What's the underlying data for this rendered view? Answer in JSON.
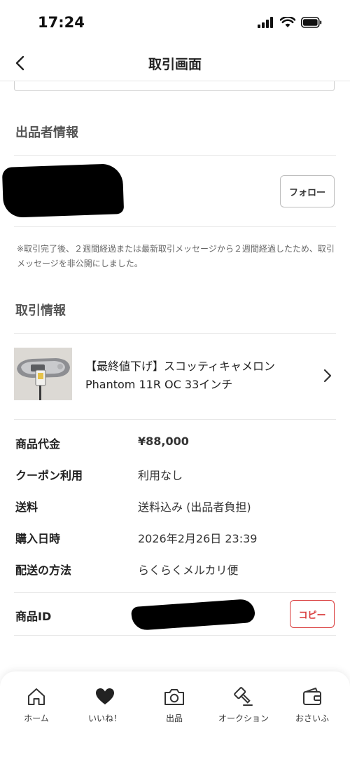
{
  "status_bar": {
    "time": "17:24"
  },
  "nav": {
    "title": "取引画面"
  },
  "seller_section": {
    "title": "出品者情報",
    "follow_label": "フォロー"
  },
  "notice": "※取引完了後、２週間経過または最新取引メッセージから２週間経過したため、取引メッセージを非公開にしました。",
  "transaction_section": {
    "title": "取引情報"
  },
  "product": {
    "title": "【最終値下げ】スコッティキャメロン Phantom 11R OC 33インチ"
  },
  "details": [
    {
      "label": "商品代金",
      "value": "¥88,000"
    },
    {
      "label": "クーポン利用",
      "value": "利用なし"
    },
    {
      "label": "送料",
      "value": "送料込み (出品者負担)"
    },
    {
      "label": "購入日時",
      "value": "2026年2月26日 23:39"
    },
    {
      "label": "配送の方法",
      "value": "らくらくメルカリ便"
    }
  ],
  "product_id": {
    "label": "商品ID",
    "copy_label": "コピー"
  },
  "tabs": [
    {
      "label": "ホーム",
      "icon": "home-icon"
    },
    {
      "label": "いいね！",
      "icon": "heart-icon"
    },
    {
      "label": "出品",
      "icon": "camera-icon"
    },
    {
      "label": "オークション",
      "icon": "gavel-icon"
    },
    {
      "label": "おさいふ",
      "icon": "wallet-icon"
    }
  ],
  "colors": {
    "accent_red": "#d93b3b",
    "text": "#222222",
    "muted": "#666666",
    "divider": "#e8e8e8"
  }
}
